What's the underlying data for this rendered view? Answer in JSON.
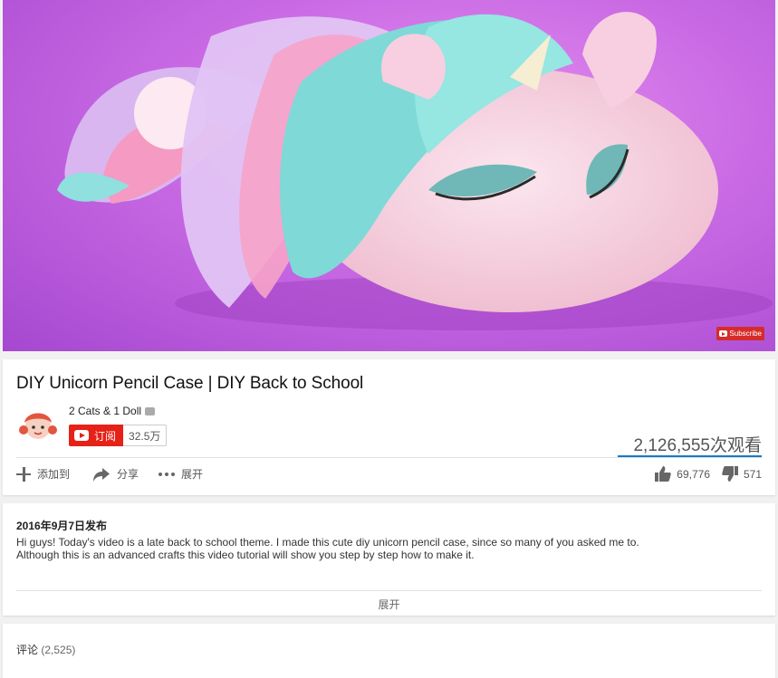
{
  "player": {
    "subscribe_overlay": "Subscribe"
  },
  "video": {
    "title": "DIY Unicorn Pencil Case | DIY Back to School",
    "views": "2,126,555次观看"
  },
  "channel": {
    "name": "2 Cats & 1 Doll",
    "subscribe_label": "订阅",
    "subscriber_count": "32.5万"
  },
  "actions": {
    "add_to": "添加到",
    "share": "分享",
    "more": "展开",
    "likes": "69,776",
    "dislikes": "571"
  },
  "description": {
    "published": "2016年9月7日发布",
    "line1": "Hi guys! Today's video is a late back to school theme. I made this cute diy unicorn pencil case, since so many of you asked me to.",
    "line2": "Although this is an advanced crafts this video tutorial will show you step by step how to make it.",
    "expand": "展开"
  },
  "comments": {
    "label": "评论",
    "count": "(2,525)"
  },
  "colors": {
    "subscribe_red": "#e62117",
    "view_bar": "#167ac6",
    "player_bg": "#c96ae4"
  },
  "icons": [
    "plus-icon",
    "share-icon",
    "more-dots-icon",
    "thumbs-up-icon",
    "thumbs-down-icon",
    "youtube-play-icon",
    "verified-icon"
  ]
}
